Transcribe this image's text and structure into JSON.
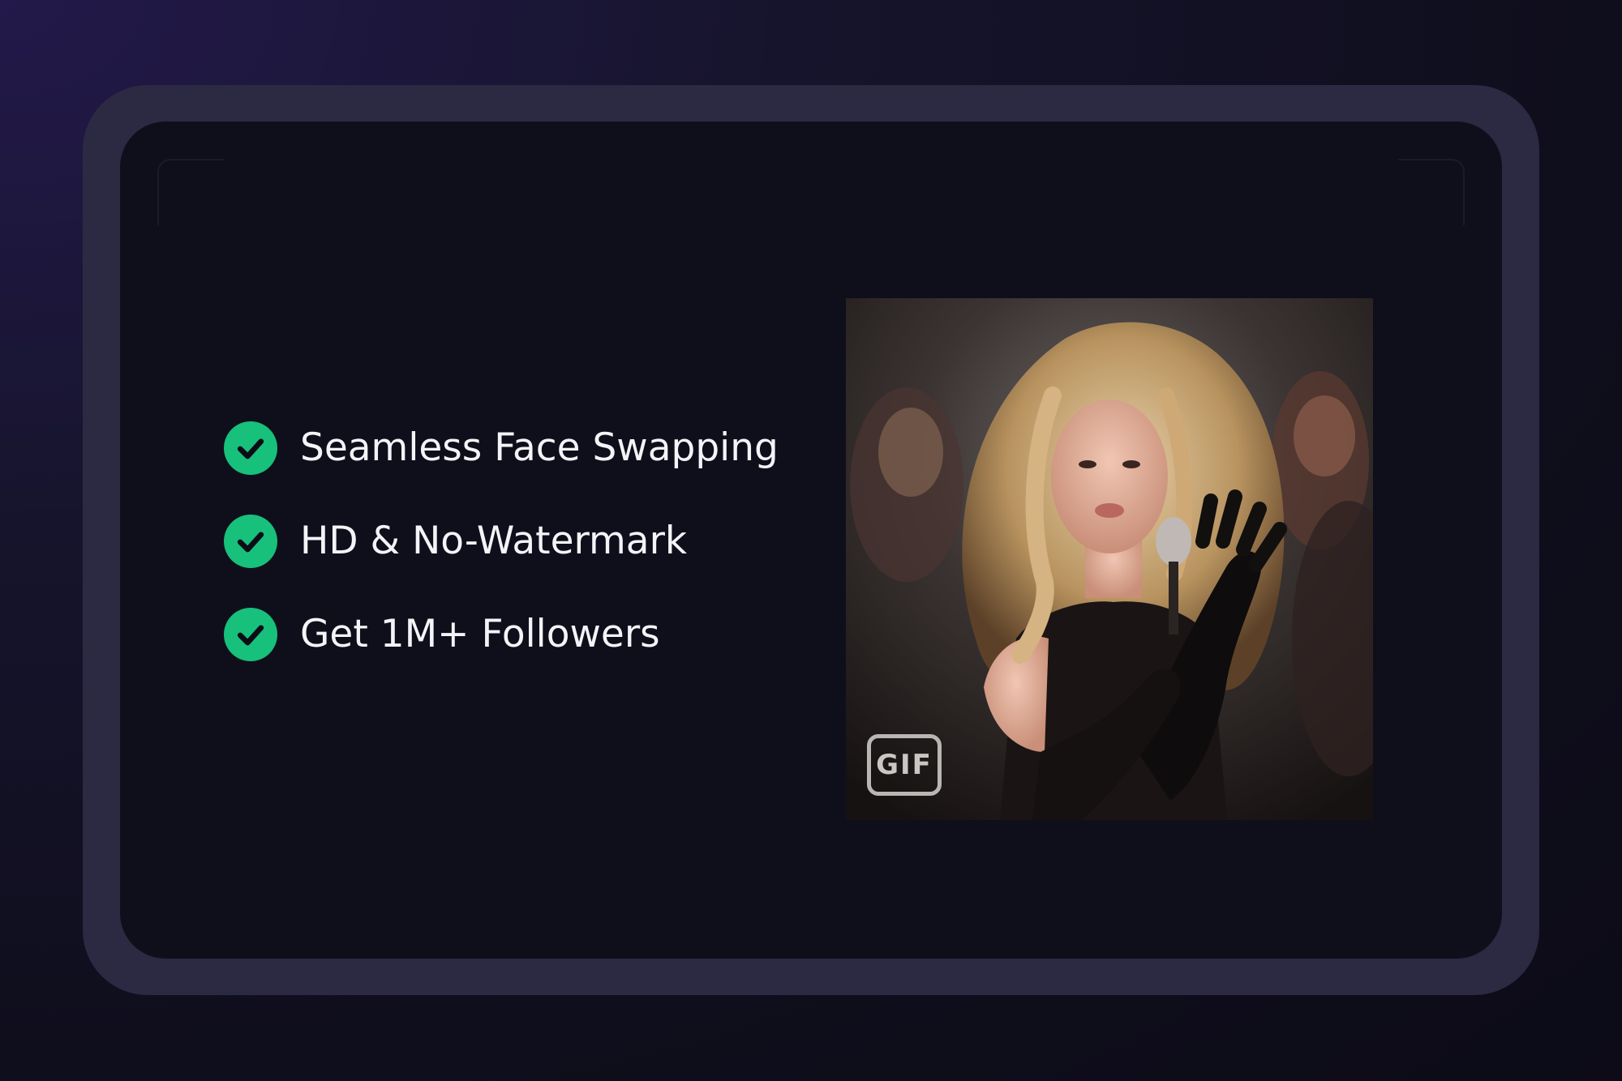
{
  "features": [
    {
      "label": "Seamless Face Swapping",
      "icon": "check-circle-icon"
    },
    {
      "label": "HD & No-Watermark",
      "icon": "check-circle-icon"
    },
    {
      "label": "Get 1M+ Followers",
      "icon": "check-circle-icon"
    }
  ],
  "media": {
    "badge": "GIF",
    "alt": "Performer on stage"
  },
  "colors": {
    "accent": "#17c07b",
    "frame": "#2b2a42",
    "panel": "#0f0f1c",
    "text": "#f4f4f8"
  }
}
